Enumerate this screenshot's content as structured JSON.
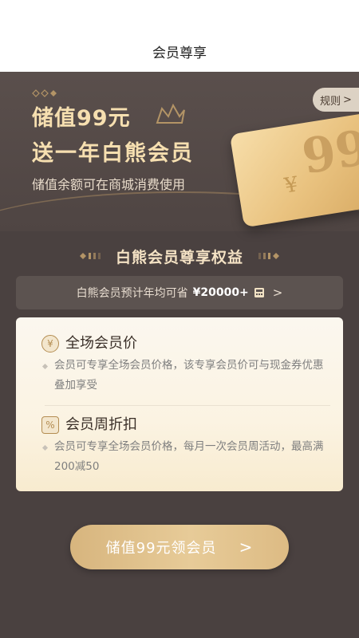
{
  "header": {
    "title": "会员尊享"
  },
  "hero": {
    "line1": "储值99元",
    "line2": "送一年白熊会员",
    "subtitle": "储值余额可在商城消费使用",
    "rules_label": "规则",
    "rules_chevron": ">",
    "card_currency": "¥",
    "card_amount": "99"
  },
  "section": {
    "title": "白熊会员尊享权益"
  },
  "savings": {
    "label": "白熊会员预计年均可省",
    "amount": "¥20000+",
    "chevron": ">"
  },
  "benefits": [
    {
      "icon": "yen-coin-icon",
      "icon_glyph": "¥",
      "title": "全场会员价",
      "desc": "会员可专享全场会员价格，该专享会员价可与现金券优惠叠加享受"
    },
    {
      "icon": "discount-tag-icon",
      "icon_glyph": "%",
      "title": "会员周折扣",
      "desc": "会员可专享全场会员价格，每月一次会员周活动，最高满200减50"
    }
  ],
  "cta": {
    "label": "储值99元领会员",
    "chevron": ">"
  },
  "colors": {
    "background": "#4a4140",
    "accent_gold": "#f6dfb0",
    "button_gold": "#e7cb98"
  }
}
